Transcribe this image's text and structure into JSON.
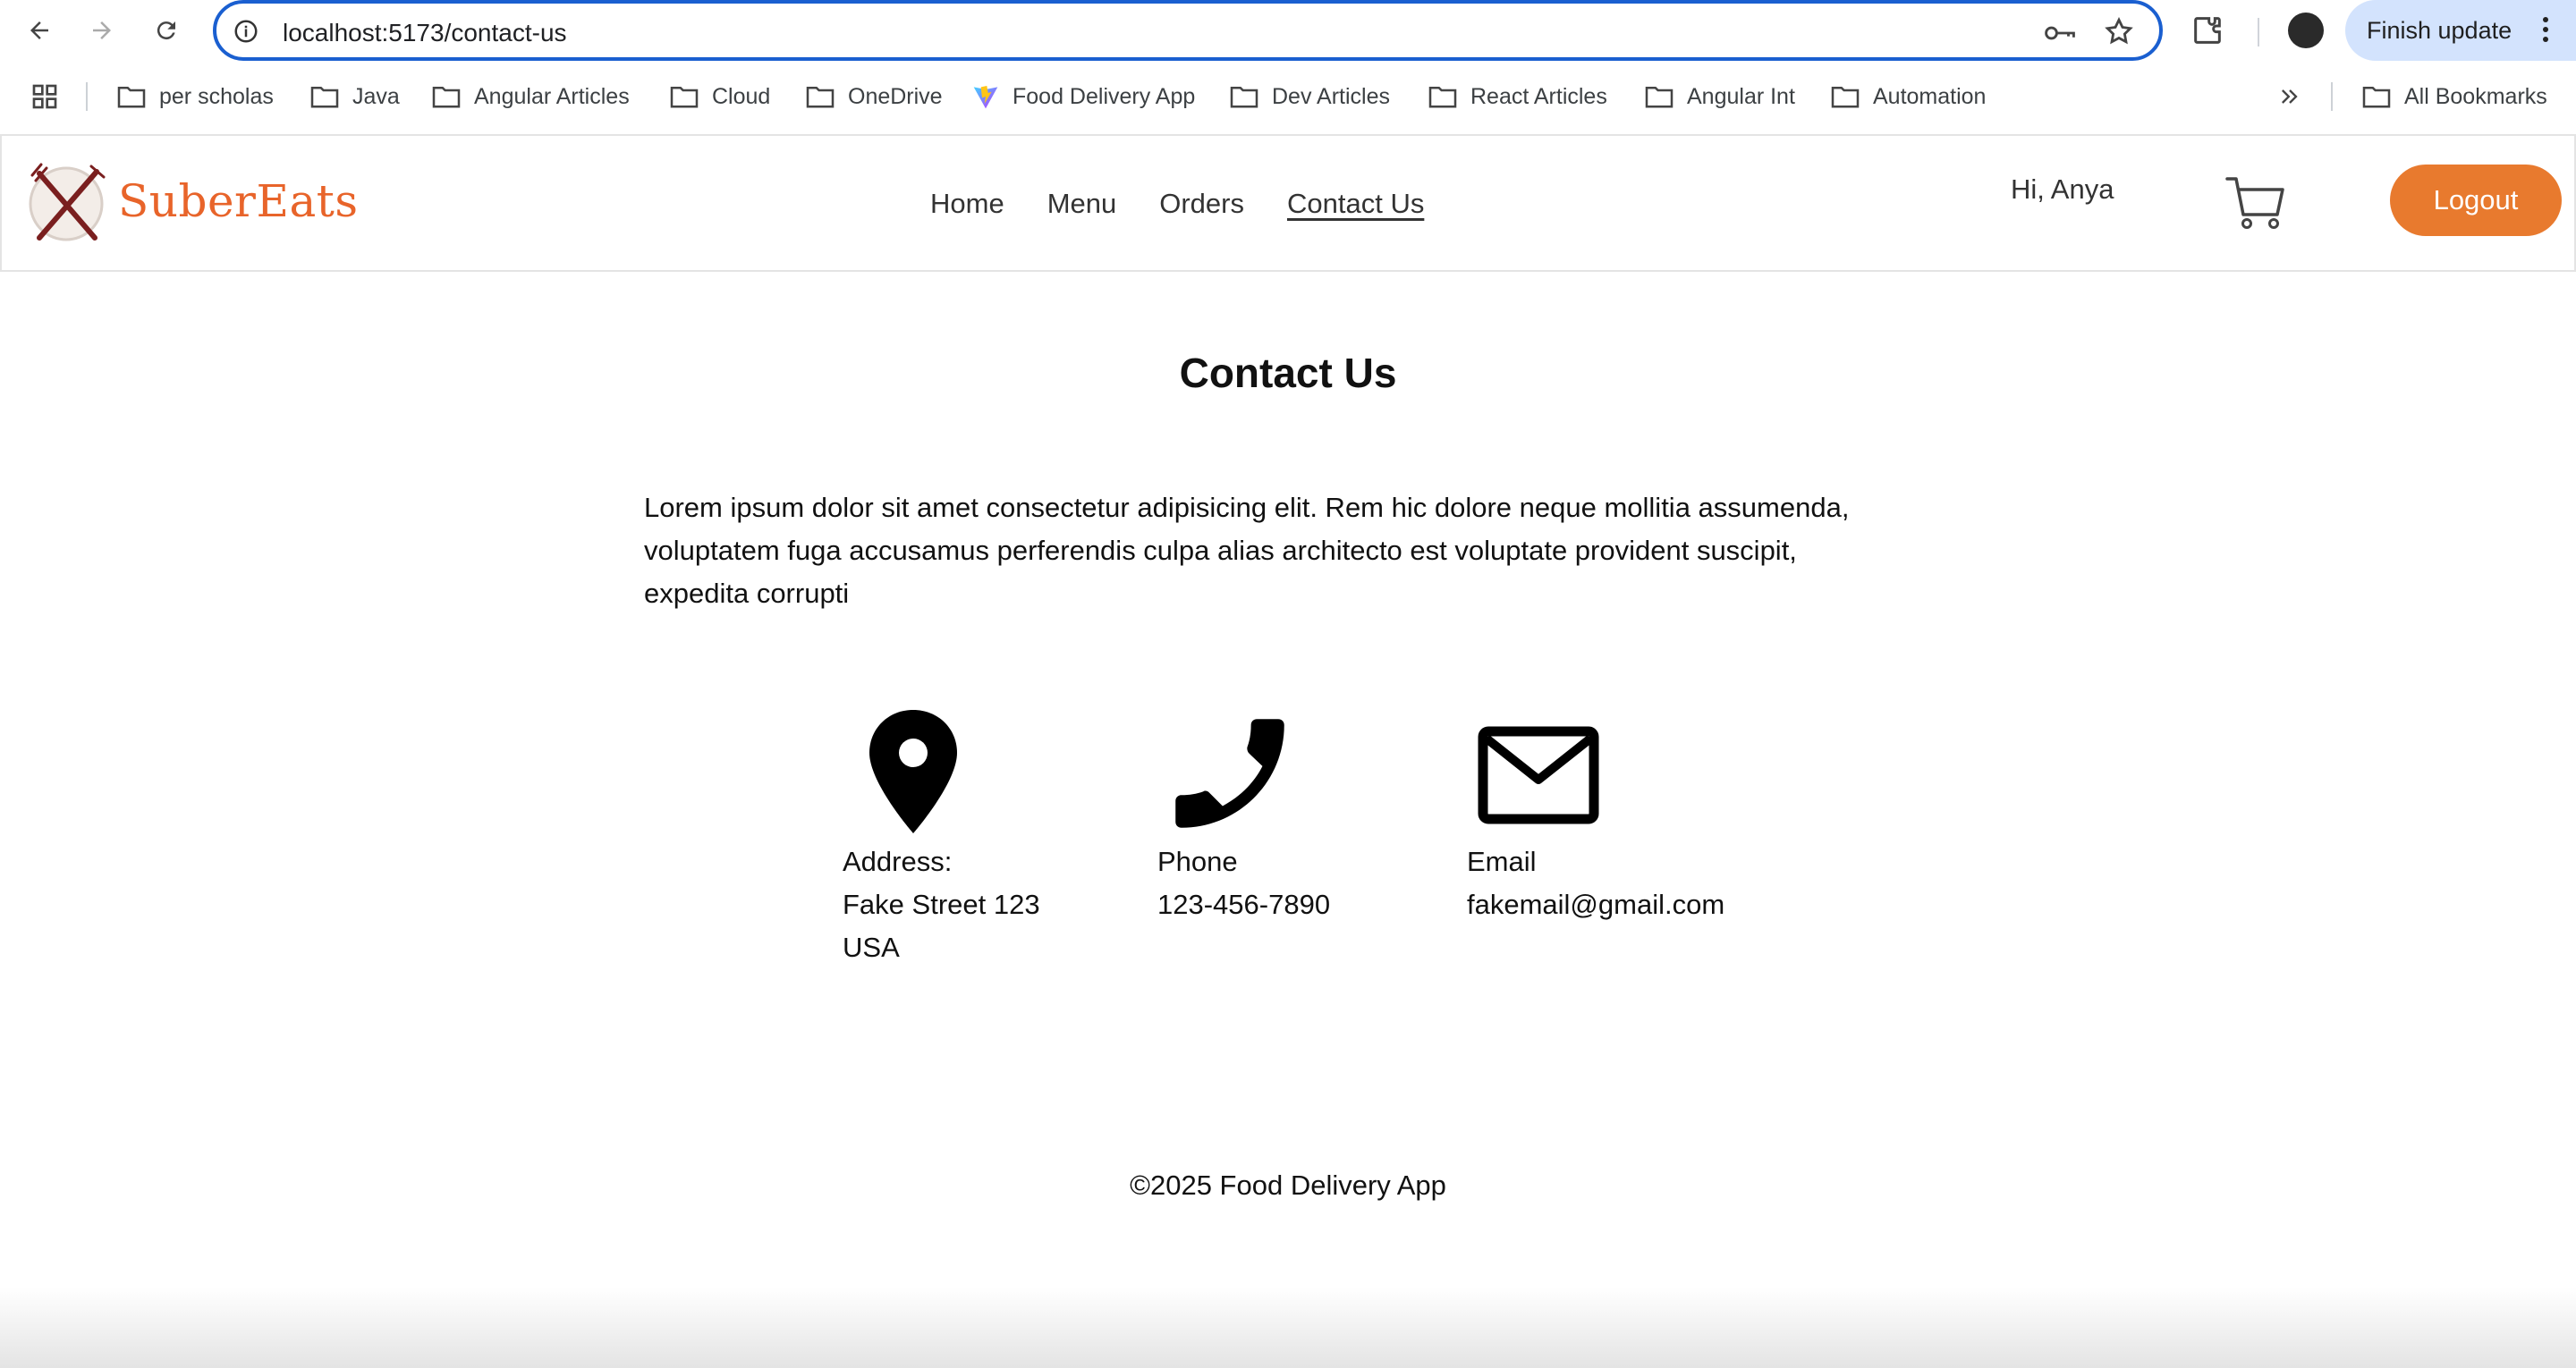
{
  "browser": {
    "url": "localhost:5173/contact-us",
    "finish_update_label": "Finish update",
    "bookmarks": [
      {
        "label": "per scholas",
        "icon": "folder-icon"
      },
      {
        "label": "Java",
        "icon": "folder-icon"
      },
      {
        "label": "Angular Articles",
        "icon": "folder-icon"
      },
      {
        "label": "Cloud",
        "icon": "folder-icon"
      },
      {
        "label": "OneDrive",
        "icon": "folder-icon"
      },
      {
        "label": "Food Delivery App",
        "icon": "vite-icon"
      },
      {
        "label": "Dev Articles",
        "icon": "folder-icon"
      },
      {
        "label": "React Articles",
        "icon": "folder-icon"
      },
      {
        "label": "Angular Int",
        "icon": "folder-icon"
      },
      {
        "label": "Automation",
        "icon": "folder-icon"
      }
    ],
    "all_bookmarks_label": "All Bookmarks"
  },
  "header": {
    "logo_text": "SuberEats",
    "nav": [
      {
        "label": "Home",
        "active": false
      },
      {
        "label": "Menu",
        "active": false
      },
      {
        "label": "Orders",
        "active": false
      },
      {
        "label": "Contact Us",
        "active": true
      }
    ],
    "greeting": "Hi, Anya",
    "logout_label": "Logout"
  },
  "main": {
    "title": "Contact Us",
    "intro_lines": [
      "Lorem ipsum dolor sit amet consectetur adipisicing elit. Rem hic dolore neque mollitia assumenda,",
      "voluptatem fuga accusamus perferendis culpa alias architecto est voluptate provident suscipit,",
      "expedita corrupti"
    ],
    "contacts": [
      {
        "icon": "location-pin-icon",
        "label": "Address:",
        "lines": [
          "Fake Street 123",
          "USA"
        ]
      },
      {
        "icon": "phone-icon",
        "label": "Phone",
        "lines": [
          "123-456-7890"
        ]
      },
      {
        "icon": "mail-icon",
        "label": "Email",
        "lines": [
          "fakemail@gmail.com"
        ]
      }
    ]
  },
  "footer": {
    "text": "©2025 Food Delivery App"
  },
  "colors": {
    "brand_orange": "#e87a2e",
    "logo_orange": "#e8642a",
    "omnibox_border": "#1a5fd0",
    "update_pill": "#d3e3fd"
  }
}
